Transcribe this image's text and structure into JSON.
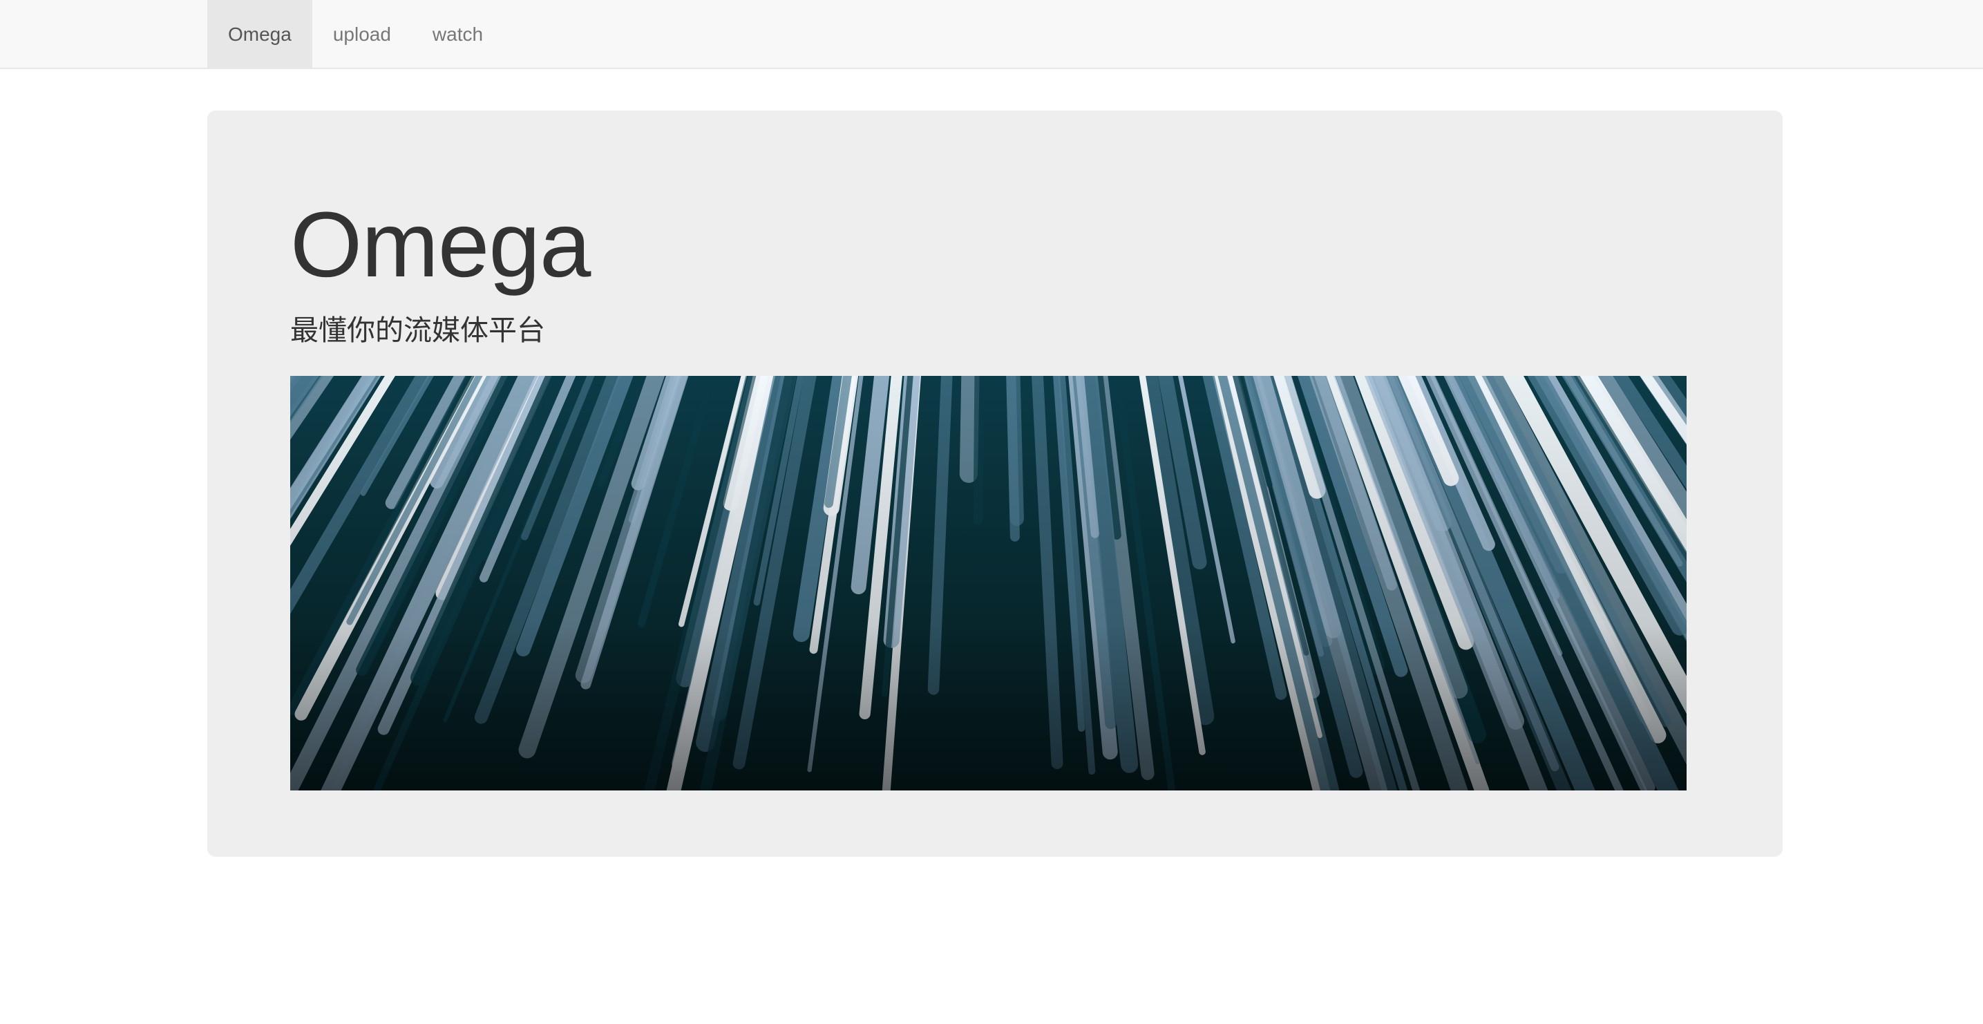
{
  "nav": {
    "items": [
      {
        "label": "Omega",
        "active": true
      },
      {
        "label": "upload",
        "active": false
      },
      {
        "label": "watch",
        "active": false
      }
    ]
  },
  "hero": {
    "title": "Omega",
    "subtitle": "最懂你的流媒体平台",
    "image": {
      "palette": {
        "background": "#062226",
        "dark": "#0b3b47",
        "mid": "#4d7b93",
        "light": "#9fbad1",
        "highlight": "#f4f9fd"
      }
    }
  }
}
